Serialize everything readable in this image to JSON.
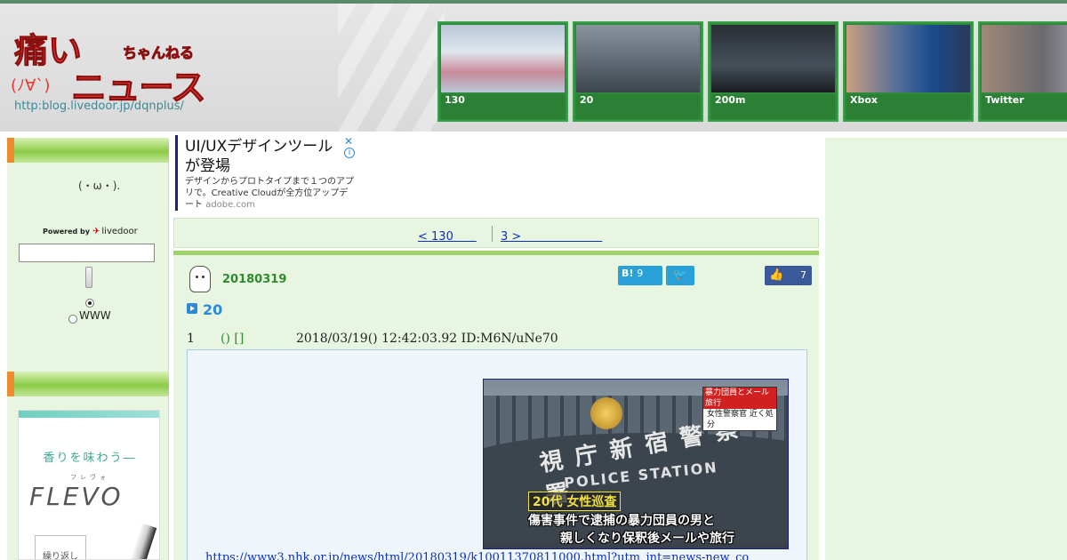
{
  "header": {
    "logo": {
      "line1": "痛い",
      "line2": "ちゃんねる",
      "face": "(ﾉ∀`)",
      "line3": "ニュース",
      "url": "http:blog.livedoor.jp/dqnplus/"
    },
    "thumbnails": [
      {
        "caption": "130"
      },
      {
        "caption": "20"
      },
      {
        "caption": "200m"
      },
      {
        "caption": "Xbox"
      },
      {
        "caption": "Twitter"
      }
    ]
  },
  "sidebar": {
    "face": "(・ω・).",
    "powered_by": "Powered by",
    "livedoor": "livedoor",
    "search_value": "",
    "radio_www": "WWW",
    "ad": {
      "tagline": "香りを味わう―",
      "ruby": "フレヴォ",
      "brand": "FLEVO",
      "button": "繰り返し"
    }
  },
  "topad": {
    "headline": "UI/UXデザインツールが登場",
    "description": "デザインからプロトタイプまで１つのアプリで。Creative Cloudが全方位アップデート",
    "source": "adobe.com"
  },
  "pager": {
    "prev": "< 130　　",
    "next": "3 >　　　　　　　"
  },
  "article": {
    "date": "20180319",
    "hatena_label": "B!",
    "hatena_count": "9",
    "like_count": "7",
    "title": "20",
    "post": {
      "number": "1",
      "name": "() []",
      "meta": "2018/03/19() 12:42:03.92 ID:M6N/uNe70"
    },
    "image": {
      "tag_red": "暴力団員とメール旅行",
      "tag_white": "女性警察官 近く処分",
      "kanji": "視庁新宿警察署",
      "english": "POLICE STATION",
      "caption1": "20代 女性巡査",
      "caption2": "傷害事件で逮捕の暴力団員の男と",
      "caption3": "親しくなり保釈後メールや旅行"
    },
    "link": "https://www3.nhk.or.jp/news/html/20180319/k10011370811000.html?utm_int=news-new_co"
  },
  "colors": {
    "accent_green": "#9ed36a",
    "link_blue": "#0b2fbf",
    "title_blue": "#2a8ad8",
    "date_green": "#2e8a2e"
  }
}
